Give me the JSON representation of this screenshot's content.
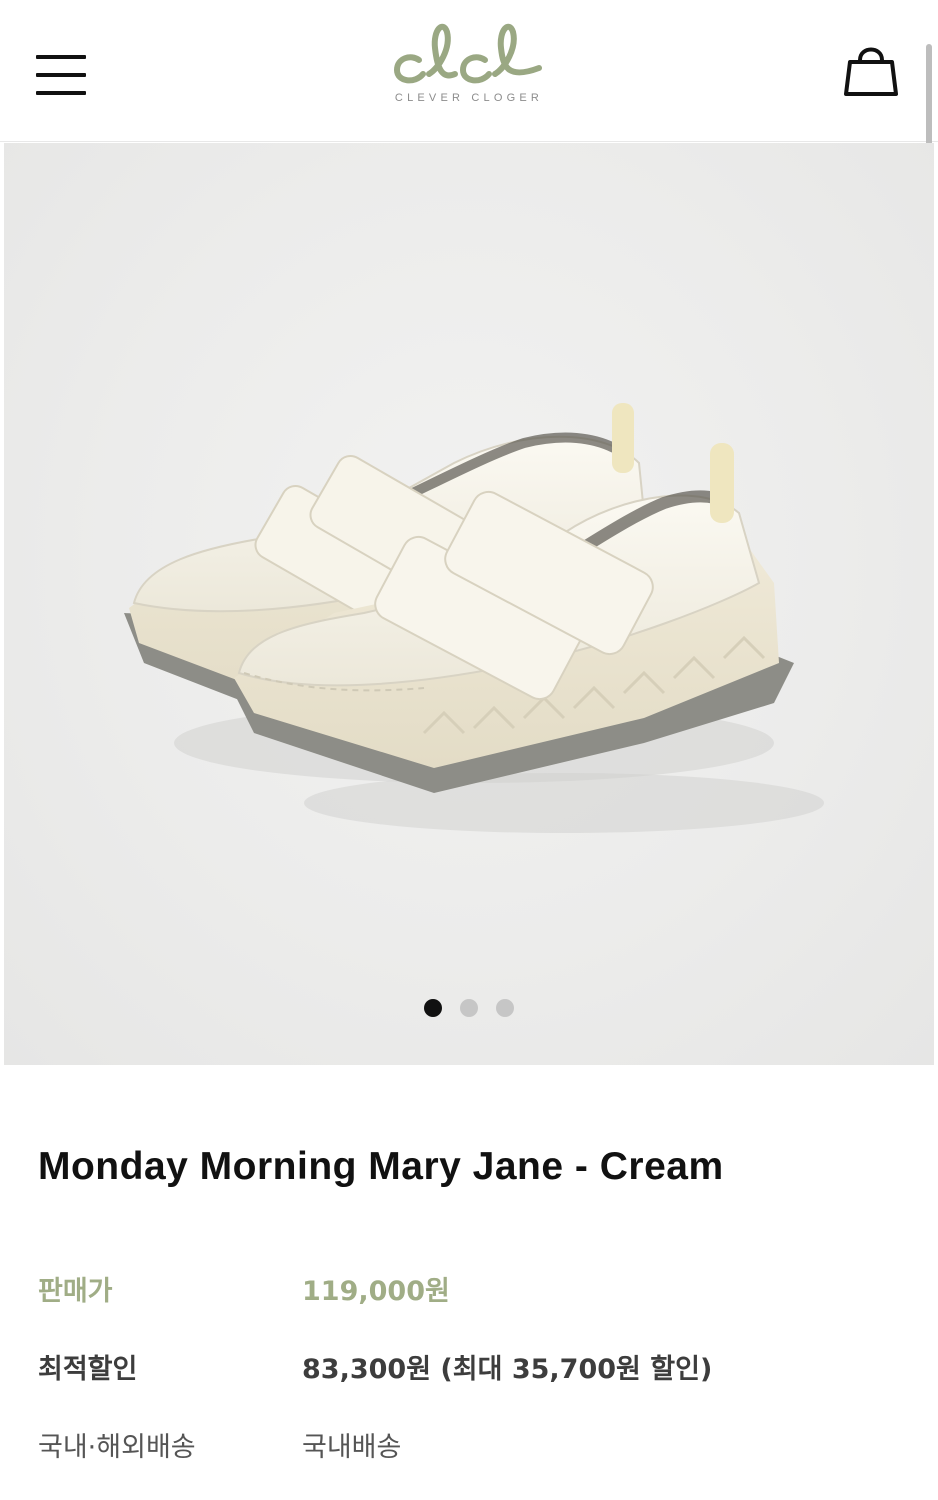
{
  "header": {
    "logo_script": "clcl",
    "logo_text": "CLEVER CLOGER",
    "menu_icon": "hamburger-menu-icon",
    "cart_icon": "shopping-bag-icon"
  },
  "gallery": {
    "image": "cream-mary-jane-sneakers-photo",
    "slide_count": 3,
    "active_slide": 1
  },
  "product": {
    "title": "Monday Morning Mary Jane - Cream",
    "price_label": "판매가",
    "price_value": "119,000원",
    "discount_label": "최적할인",
    "discount_value": "83,300원 (최대 35,700원 할인)",
    "shipping_label": "국내·해외배송",
    "shipping_value": "국내배송"
  },
  "colors": {
    "brand_sage": "#a0ad86",
    "text_dark": "#111111",
    "dot_inactive": "#c6c6c6"
  }
}
